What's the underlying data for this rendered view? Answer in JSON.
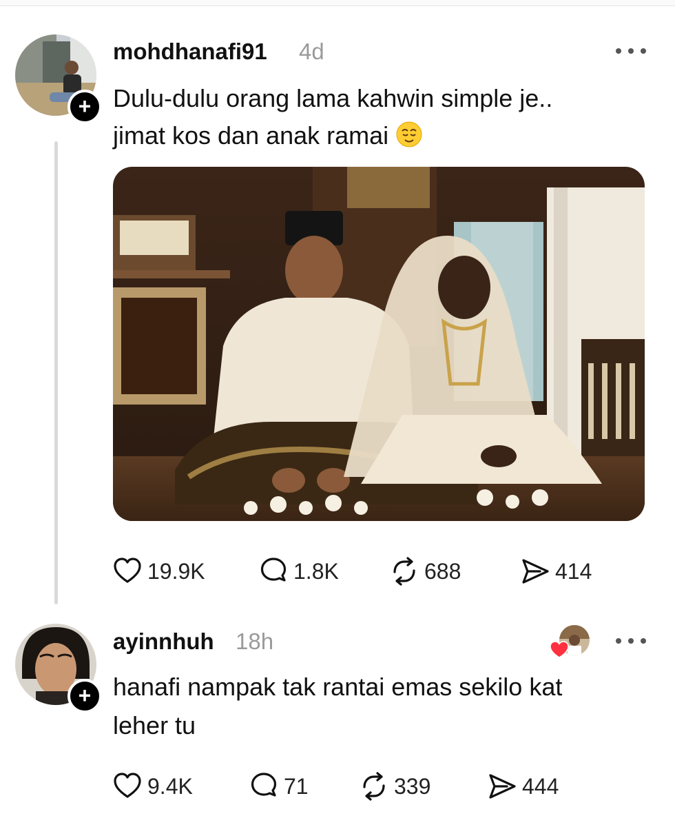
{
  "post": {
    "username": "mohdhanafi91",
    "time": "4d",
    "text_line1": "Dulu-dulu orang lama kahwin simple je..",
    "text_line2": "jimat kos dan anak ramai",
    "emoji": "relieved-face",
    "stats": {
      "likes": "19.9K",
      "replies": "1.8K",
      "reposts": "688",
      "shares": "414"
    }
  },
  "reply": {
    "username": "ayinnhuh",
    "time": "18h",
    "text_line1": "hanafi nampak tak rantai emas sekilo kat",
    "text_line2": "leher tu",
    "stats": {
      "likes": "9.4K",
      "replies": "71",
      "reposts": "339",
      "shares": "444"
    }
  },
  "colors": {
    "heart_badge": "#ff3040",
    "text": "#111111",
    "muted": "#9a9a9a"
  }
}
